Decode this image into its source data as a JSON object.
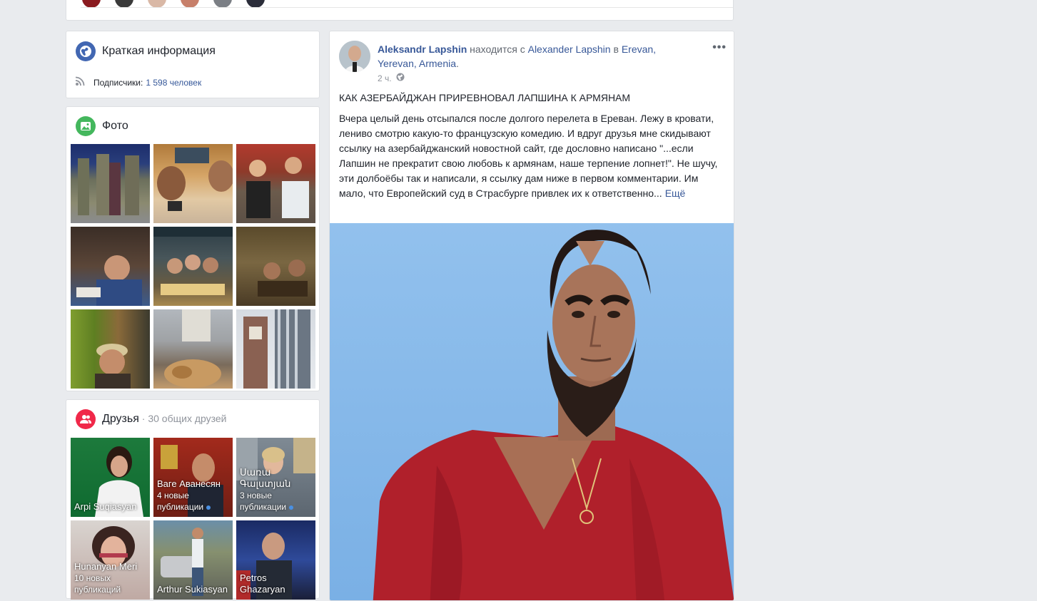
{
  "intro": {
    "title": "Краткая информация",
    "subscribers_label": "Подписчики:",
    "subscribers_value": "1 598 человек"
  },
  "photos": {
    "title": "Фото"
  },
  "friends": {
    "title": "Друзья",
    "subtitle": " · 30 общих друзей",
    "items": [
      {
        "name": "Arpi Suqiasyan",
        "note": ""
      },
      {
        "name": "Ваге Аванесян",
        "note": "4 новые публикации"
      },
      {
        "name": "Սառա Գալստյան",
        "note": "3 новые публикации"
      },
      {
        "name": "Hunanyan Meri",
        "note": "10 новых публикаций"
      },
      {
        "name": "Arthur Sukiasyan",
        "note": ""
      },
      {
        "name": "Petros Ghazaryan",
        "note": ""
      }
    ]
  },
  "post": {
    "author": "Aleksandr Lapshin",
    "status_text": " находится с ",
    "with_name": "Alexander Lapshin",
    "in_text": " в ",
    "location": "Erevan, Yerevan, Armenia",
    "period": ".",
    "time": "2 ч.",
    "title": "КАК АЗЕРБАЙДЖАН ПРИРЕВНОВАЛ ЛАПШИНА К АРМЯНАМ",
    "body": "Вчера целый день отсыпался после долгого перелета в Ереван. Лежу в кровати, лениво смотрю какую-то французскую комедию. И вдруг друзья мне скидывают ссылку на азербайджанский новостной сайт, где дословно написано \"...если Лапшин не прекратит свою любовь к армянам, наше терпение лопнет!\". Не шучу, эти долбоёбы так и написали, я ссылку дам ниже в первом комментарии. Им мало, что Европейский суд в Страсбурге привлек их к ответственно...",
    "more_label": "Ещё"
  },
  "colors": {
    "page_bg": "#e9ebee",
    "link": "#385898",
    "intro_icon": "#4267b2",
    "photos_icon": "#44b75d",
    "friends_icon": "#f02849",
    "photo_bg": "#7fb4e8",
    "shirt": "#b0202b"
  }
}
